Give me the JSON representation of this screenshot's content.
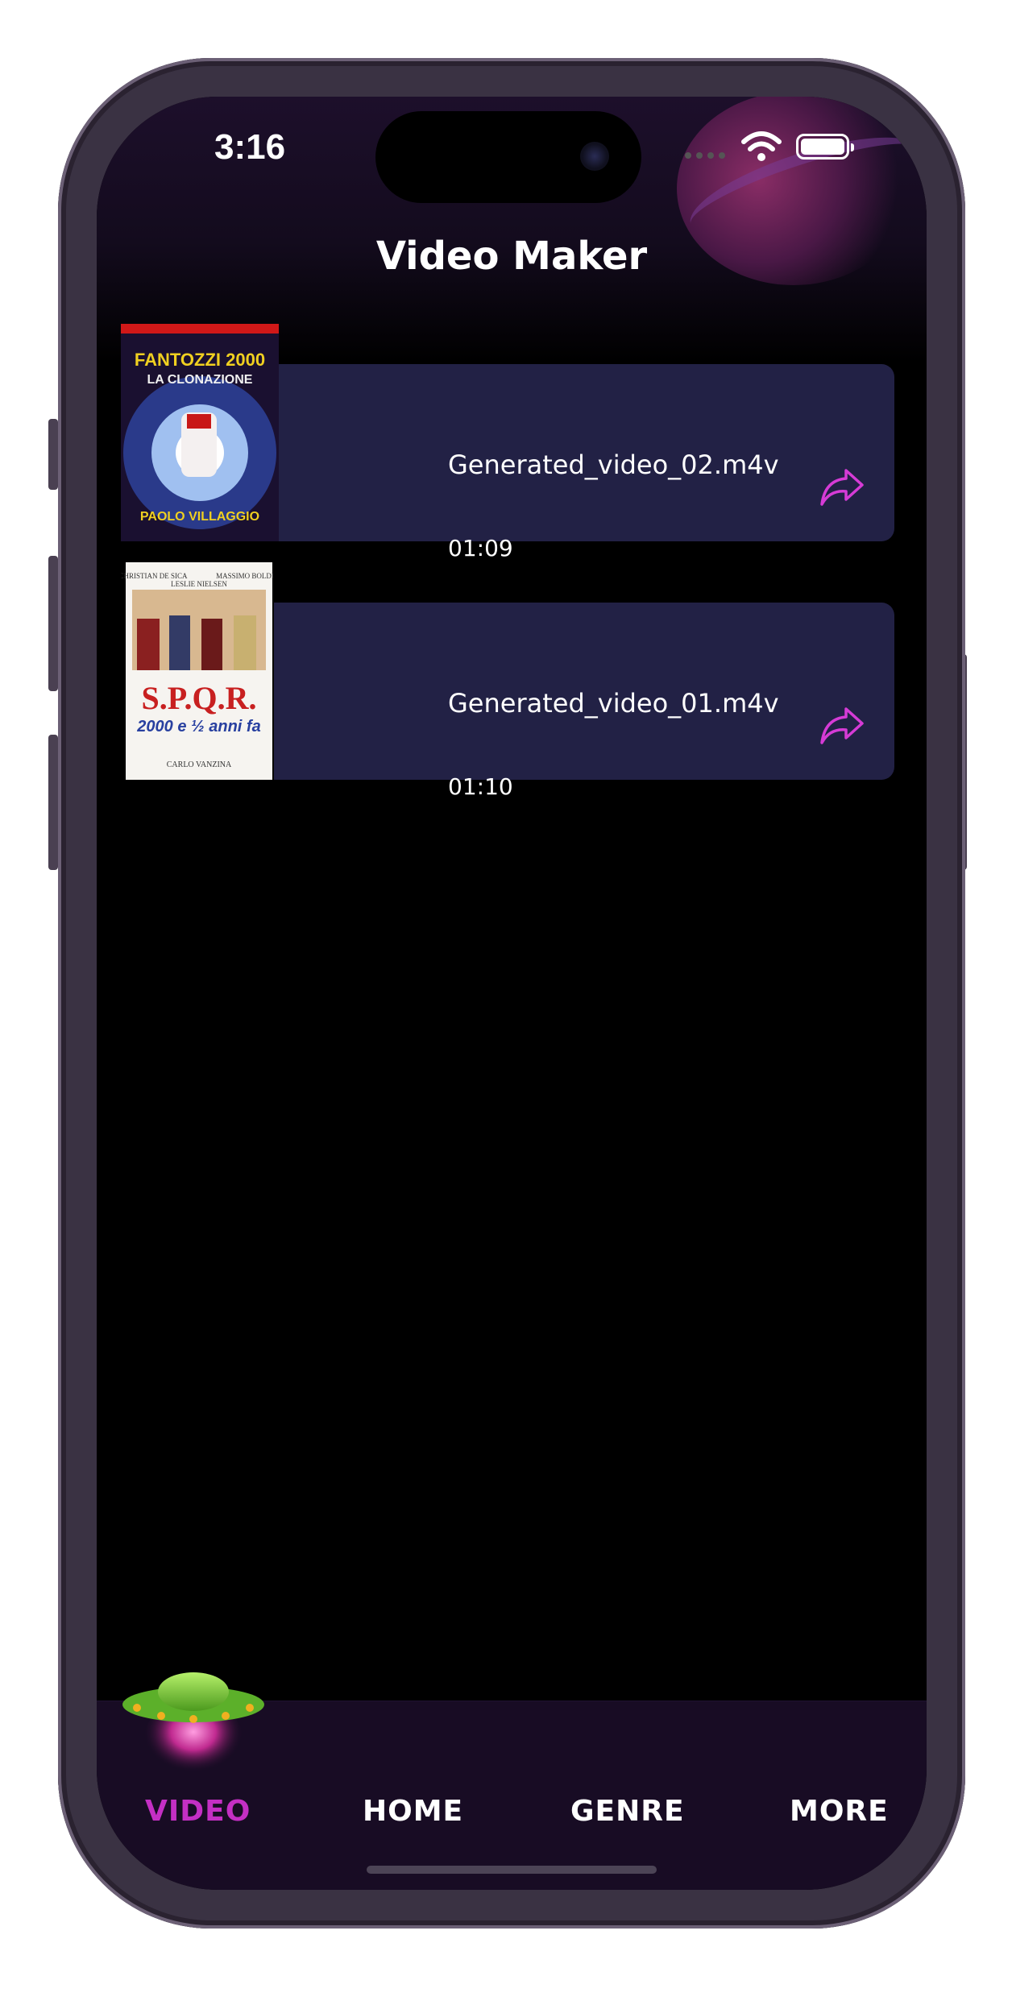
{
  "status_bar": {
    "time": "3:16"
  },
  "header": {
    "title": "Video Maker"
  },
  "videos": [
    {
      "name": "Generated_video_02.m4v",
      "duration": "01:09",
      "poster_title": "FANTOZZI 2000",
      "poster_subtitle": "LA CLONAZIONE",
      "poster_footer": "PAOLO VILLAGGIO"
    },
    {
      "name": "Generated_video_01.m4v",
      "duration": "01:10",
      "poster_cast": [
        "CHRISTIAN DE SICA",
        "LESLIE NIELSEN",
        "MASSIMO BOLDI"
      ],
      "poster_title": "S.P.Q.R.",
      "poster_subtitle": "2000 e ½ anni fa",
      "poster_footer": "CARLO VANZINA"
    }
  ],
  "tabs": [
    {
      "label": "VIDEO",
      "active": true
    },
    {
      "label": "HOME",
      "active": false
    },
    {
      "label": "GENRE",
      "active": false
    },
    {
      "label": "MORE",
      "active": false
    }
  ],
  "colors": {
    "accent": "#c42fc4",
    "card_bg": "#222145",
    "tabbar_bg": "#180c24",
    "screen_bg": "#000000"
  },
  "icons": [
    "wifi-icon",
    "battery-icon",
    "share-icon",
    "ufo-icon"
  ]
}
